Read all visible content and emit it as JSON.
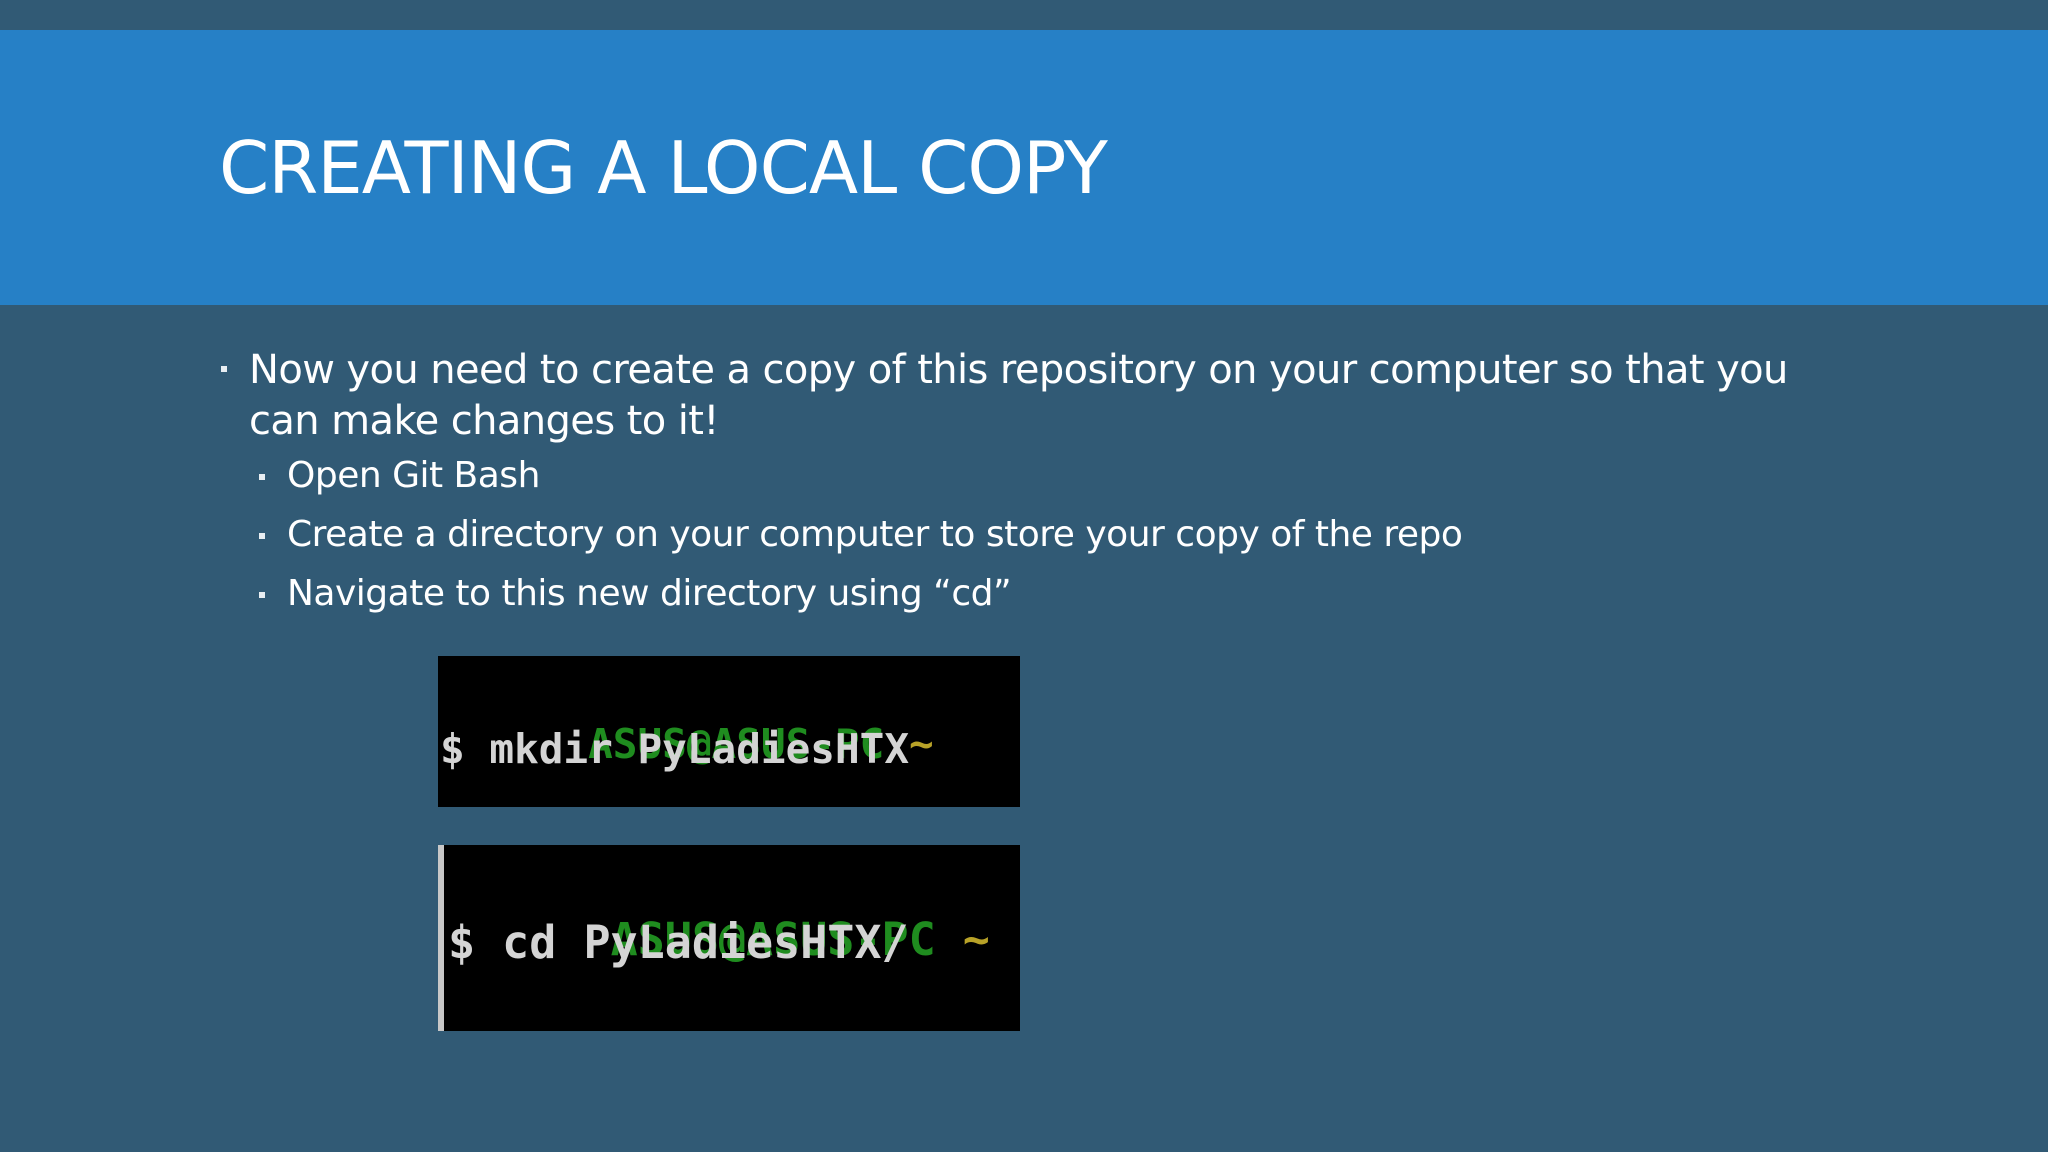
{
  "slide": {
    "title": "CREATING A LOCAL COPY",
    "bullets": {
      "main": "Now you need to create a copy of this repository on your computer so that you",
      "main_cont": "can make changes to it!",
      "sub": [
        "Open Git Bash",
        "Create a directory on your computer to store your copy of the repo",
        "Navigate to this new directory using “cd”"
      ]
    }
  },
  "terminals": [
    {
      "user": "ASUS@ASUS-PC",
      "tilde": "~",
      "command": "$ mkdir PyLadiesHTX"
    },
    {
      "user": "ASUS@ASUS-PC",
      "tilde": "~",
      "command": "$ cd PyLadiesHTX/"
    }
  ],
  "colors": {
    "background": "#315a75",
    "title_band": "#2680c6",
    "terminal_user": "#1f8c1f",
    "terminal_tilde": "#b8a228"
  }
}
